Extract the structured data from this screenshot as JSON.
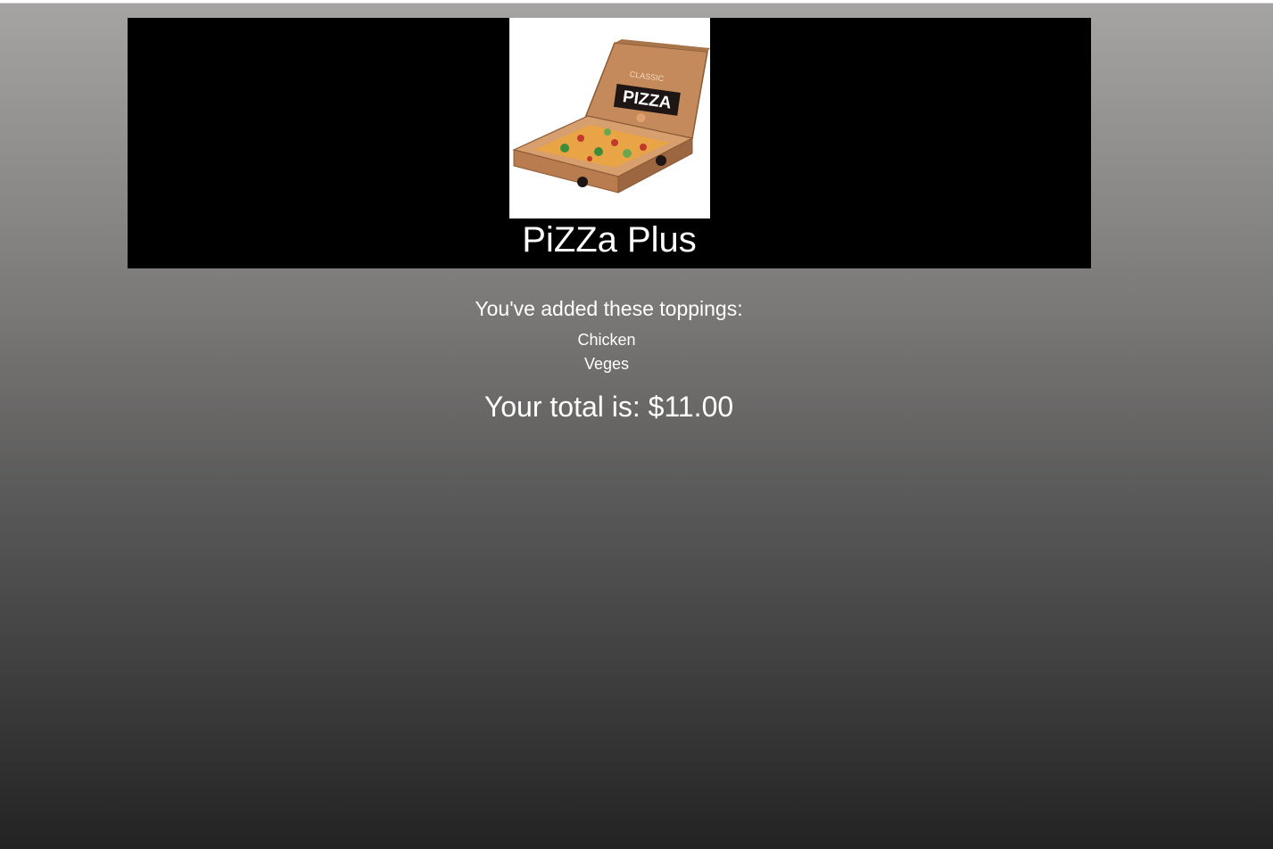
{
  "header": {
    "logo": {
      "icon": "pizza-box-logo",
      "box_text": "PIZZA",
      "box_subtext": "CLASSIC"
    },
    "title": "PiZZa Plus"
  },
  "summary": {
    "heading": "You've added these toppings:",
    "toppings": [
      "Chicken",
      "Veges"
    ],
    "total_label": "Your total is: $11.00"
  },
  "colors": {
    "header_background": "#000000",
    "text": "#ffffff",
    "background_top": "#a6a4a2",
    "background_bottom": "#232323"
  }
}
